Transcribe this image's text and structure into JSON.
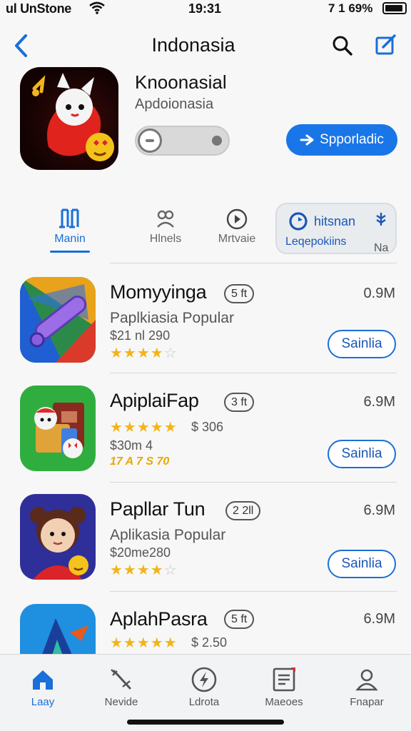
{
  "status_bar": {
    "carrier": "ul UnStone",
    "time": "19:31",
    "right_indicators": "7 1 69%"
  },
  "nav": {
    "title": "Indonasia"
  },
  "hero": {
    "name": "Knoonasial",
    "subtitle": "Apdoionasia",
    "button_label": "Spporladic",
    "colors": {
      "button": "#1976e8"
    }
  },
  "tabs": [
    {
      "label": "Manin",
      "icon": "music-bars-icon",
      "active": true
    },
    {
      "label": "Hlnels",
      "icon": "people-icon",
      "active": false
    },
    {
      "label": "Mrtvaie",
      "icon": "play-circle-icon",
      "active": false
    }
  ],
  "highlight_tab": {
    "top_label": "hitsnan",
    "bottom_label": "Leqepokiins",
    "right_label": "Na"
  },
  "apps": [
    {
      "name": "Momyyinga",
      "badge": "5 ft",
      "size": "0.9M",
      "subtitle": "Paplkiasia Popular",
      "price": "$21 nl 290",
      "rating": 4,
      "rating_max": 5,
      "button_label": "Sainlia"
    },
    {
      "name": "ApiplaiFap",
      "badge": "3 ft",
      "size": "6.9M",
      "rating": 5,
      "rating_max": 5,
      "stars_price": "$ 306",
      "price": "$30m 4",
      "yellow_text": "17 A 7 S 70",
      "button_label": "Sainlia"
    },
    {
      "name": "Papllar Tun",
      "badge": "2 2ll",
      "size": "6.9M",
      "subtitle": "Aplikasia Popular",
      "price": "$20me280",
      "rating": 4,
      "rating_max": 5,
      "button_label": "Sainlia"
    },
    {
      "name": "AplahPasra",
      "badge": "5 ft",
      "size": "6.9M",
      "rating": 5,
      "rating_max": 5,
      "stars_price": "$ 2.50"
    }
  ],
  "bottom_tabs": [
    {
      "label": "Laay",
      "icon": "home-icon",
      "active": true
    },
    {
      "label": "Nevide",
      "icon": "wand-icon",
      "active": false
    },
    {
      "label": "Ldrota",
      "icon": "lightning-circle-icon",
      "active": false
    },
    {
      "label": "Maeoes",
      "icon": "document-icon",
      "active": false
    },
    {
      "label": "Fnapar",
      "icon": "person-icon",
      "active": false
    }
  ]
}
